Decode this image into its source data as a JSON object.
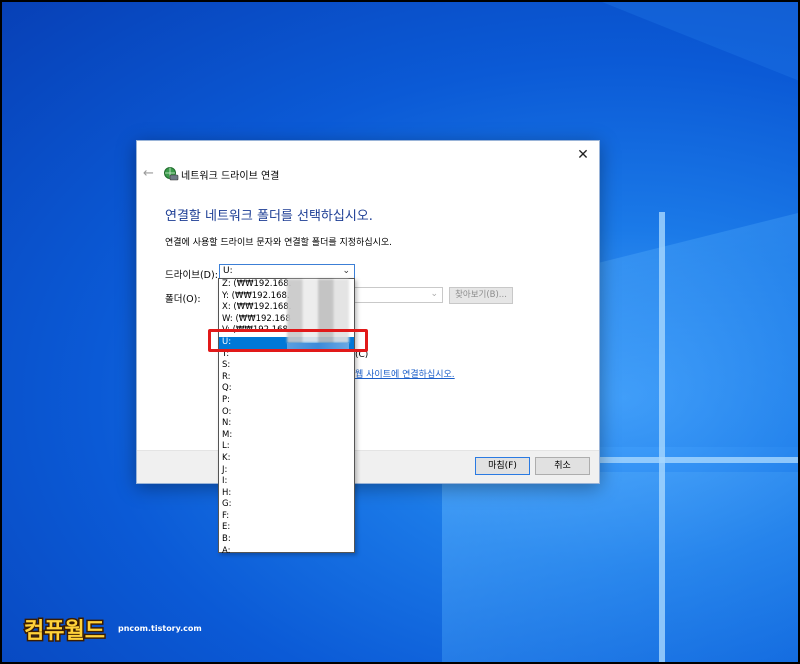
{
  "dialog": {
    "title": "네트워크 드라이브 연결",
    "close_glyph": "✕",
    "back_glyph": "←",
    "heading": "연결할 네트워크 폴더를 선택하십시오.",
    "instruction": "연결에 사용할 드라이브 문자와 연결할 폴더를 지정하십시오.",
    "drive_label": "드라이브(D):",
    "drive_value": "U:",
    "folder_label": "폴더(O):",
    "browse_label": "찾아보기(B)...",
    "checkbox_partial": "(C)",
    "link_partial": "웹 사이트에 연결하십시오.",
    "finish_label": "마침(F)",
    "cancel_label": "취소"
  },
  "dropdown": {
    "items": [
      "Z: (₩₩192.168.",
      "Y: (₩₩192.168.",
      "X: (₩₩192.168.",
      "W: (₩₩192.168",
      "V: (₩₩192.168.",
      "U:",
      "T:",
      "S:",
      "R:",
      "Q:",
      "P:",
      "O:",
      "N:",
      "M:",
      "L:",
      "K:",
      "J:",
      "I:",
      "H:",
      "G:",
      "F:",
      "E:",
      "B:",
      "A:"
    ],
    "selected_index": 5
  },
  "watermark": {
    "logo_text": "컴퓨월드",
    "url": "pncom.tistory.com"
  },
  "colors": {
    "accent": "#0078d7",
    "heading": "#1c3d94",
    "highlight": "#e11919"
  }
}
